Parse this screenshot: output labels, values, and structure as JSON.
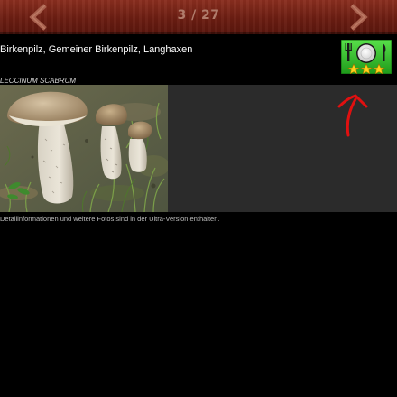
{
  "header": {
    "pager": "3 / 27",
    "prev_icon": "chevron-left-icon",
    "next_icon": "chevron-right-icon",
    "colors": {
      "bar": "#6b1d12",
      "chevron": "#a9624f",
      "pager_text": "#b07b6b"
    }
  },
  "mushroom": {
    "common_names": "Birkenpilz, Gemeiner Birkenpilz, Langhaxen",
    "latin_name": "LECCINUM SCABRUM",
    "edibility_icon": "plate-cutlery-icon",
    "rating_stars": 3,
    "rating_color": "#2fbf2a"
  },
  "content": {
    "photo_subject": "mushroom-photo",
    "info_text": "Detailinformationen und weitere Fotos sind in der Ultra-Version enthalten."
  },
  "annotation": {
    "icon": "red-arrow-icon",
    "color": "#e01010"
  }
}
